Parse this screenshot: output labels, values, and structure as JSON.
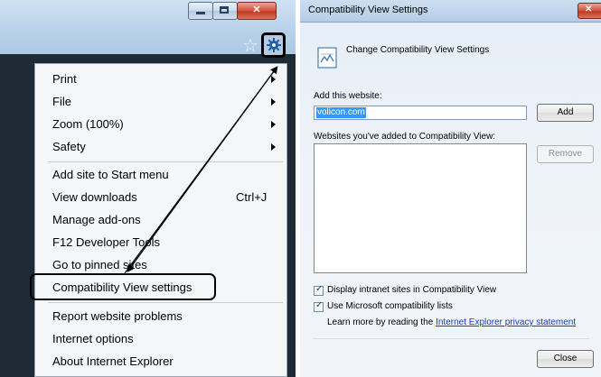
{
  "ie": {
    "window_buttons": {
      "minimize": "–",
      "maximize": "",
      "close": "✕"
    },
    "toolbar": {
      "favorites_icon": "star-icon",
      "tools_icon": "gear-icon"
    },
    "menu": {
      "items": [
        {
          "label": "Print",
          "submenu": true
        },
        {
          "label": "File",
          "submenu": true
        },
        {
          "label": "Zoom (100%)",
          "submenu": true
        },
        {
          "label": "Safety",
          "submenu": true
        },
        {
          "label": "Add site to Start menu"
        },
        {
          "label": "View downloads",
          "shortcut": "Ctrl+J"
        },
        {
          "label": "Manage add-ons"
        },
        {
          "label": "F12 Developer Tools"
        },
        {
          "label": "Go to pinned sites"
        },
        {
          "label": "Compatibility View settings",
          "highlighted": true
        },
        {
          "label": "Report website problems"
        },
        {
          "label": "Internet options"
        },
        {
          "label": "About Internet Explorer"
        }
      ]
    }
  },
  "dialog": {
    "title": "Compatibility View Settings",
    "close": "✕",
    "header": "Change Compatibility View Settings",
    "add_label": "Add this website:",
    "add_value": "volicon.com",
    "add_button": "Add",
    "list_label": "Websites you've added to Compatibility View:",
    "remove_button": "Remove",
    "checkboxes": [
      {
        "label": "Display intranet sites in Compatibility View",
        "checked": true
      },
      {
        "label": "Use Microsoft compatibility lists",
        "checked": true
      }
    ],
    "learn_more_prefix": "Learn more by reading the ",
    "learn_more_link": "Internet Explorer privacy statement",
    "close_button": "Close"
  },
  "colors": {
    "accent_blue": "#3399ff",
    "close_red": "#c13a22",
    "link": "#1a39c9"
  }
}
